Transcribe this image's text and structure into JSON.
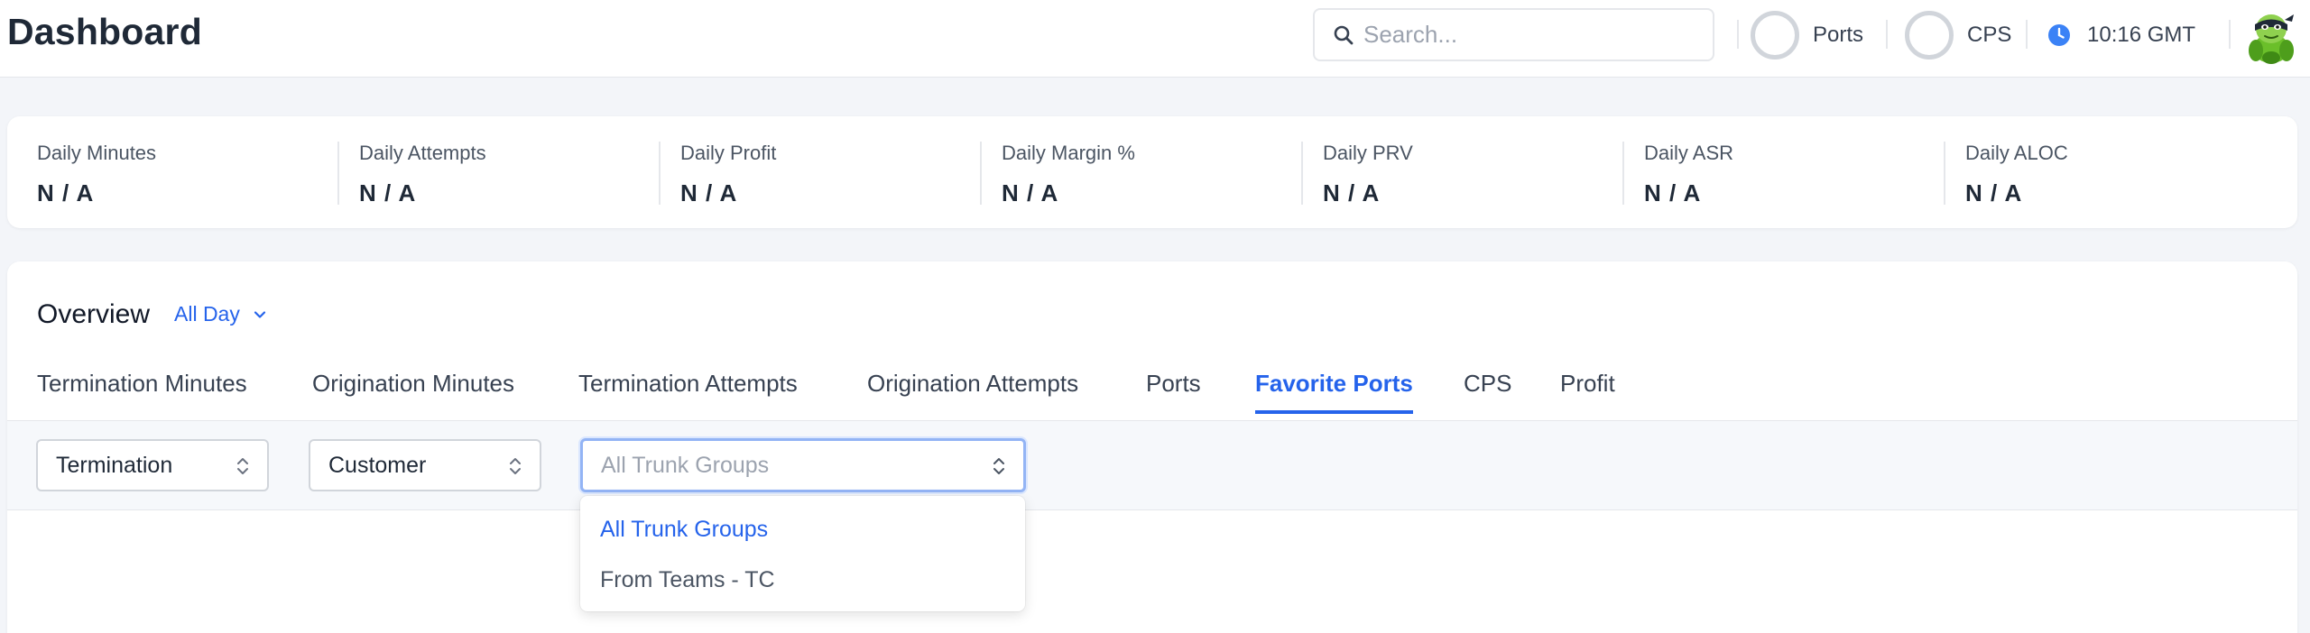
{
  "header": {
    "title": "Dashboard",
    "search_placeholder": "Search...",
    "ports_label": "Ports",
    "cps_label": "CPS",
    "time": "10:16 GMT",
    "icons": [
      "search-icon",
      "clock-icon",
      "avatar"
    ]
  },
  "stats": [
    {
      "label": "Daily Minutes",
      "value": "N / A"
    },
    {
      "label": "Daily Attempts",
      "value": "N / A"
    },
    {
      "label": "Daily Profit",
      "value": "N / A"
    },
    {
      "label": "Daily Margin %",
      "value": "N / A"
    },
    {
      "label": "Daily PRV",
      "value": "N / A"
    },
    {
      "label": "Daily ASR",
      "value": "N / A"
    },
    {
      "label": "Daily ALOC",
      "value": "N / A"
    }
  ],
  "overview": {
    "title": "Overview",
    "period": "All Day",
    "tabs": [
      {
        "label": "Termination Minutes"
      },
      {
        "label": "Origination Minutes"
      },
      {
        "label": "Termination Attempts"
      },
      {
        "label": "Origination Attempts"
      },
      {
        "label": "Ports"
      },
      {
        "label": "Favorite Ports",
        "active": true
      },
      {
        "label": "CPS"
      },
      {
        "label": "Profit"
      }
    ],
    "filters": {
      "direction": "Termination",
      "party": "Customer",
      "trunk_placeholder": "All Trunk Groups"
    },
    "dropdown": {
      "options": [
        "All Trunk Groups",
        "From Teams - TC"
      ],
      "selected": "All Trunk Groups"
    }
  },
  "colors": {
    "accent": "#2563eb",
    "background": "#f3f5f9",
    "card": "#ffffff",
    "border": "#e5e7eb"
  }
}
